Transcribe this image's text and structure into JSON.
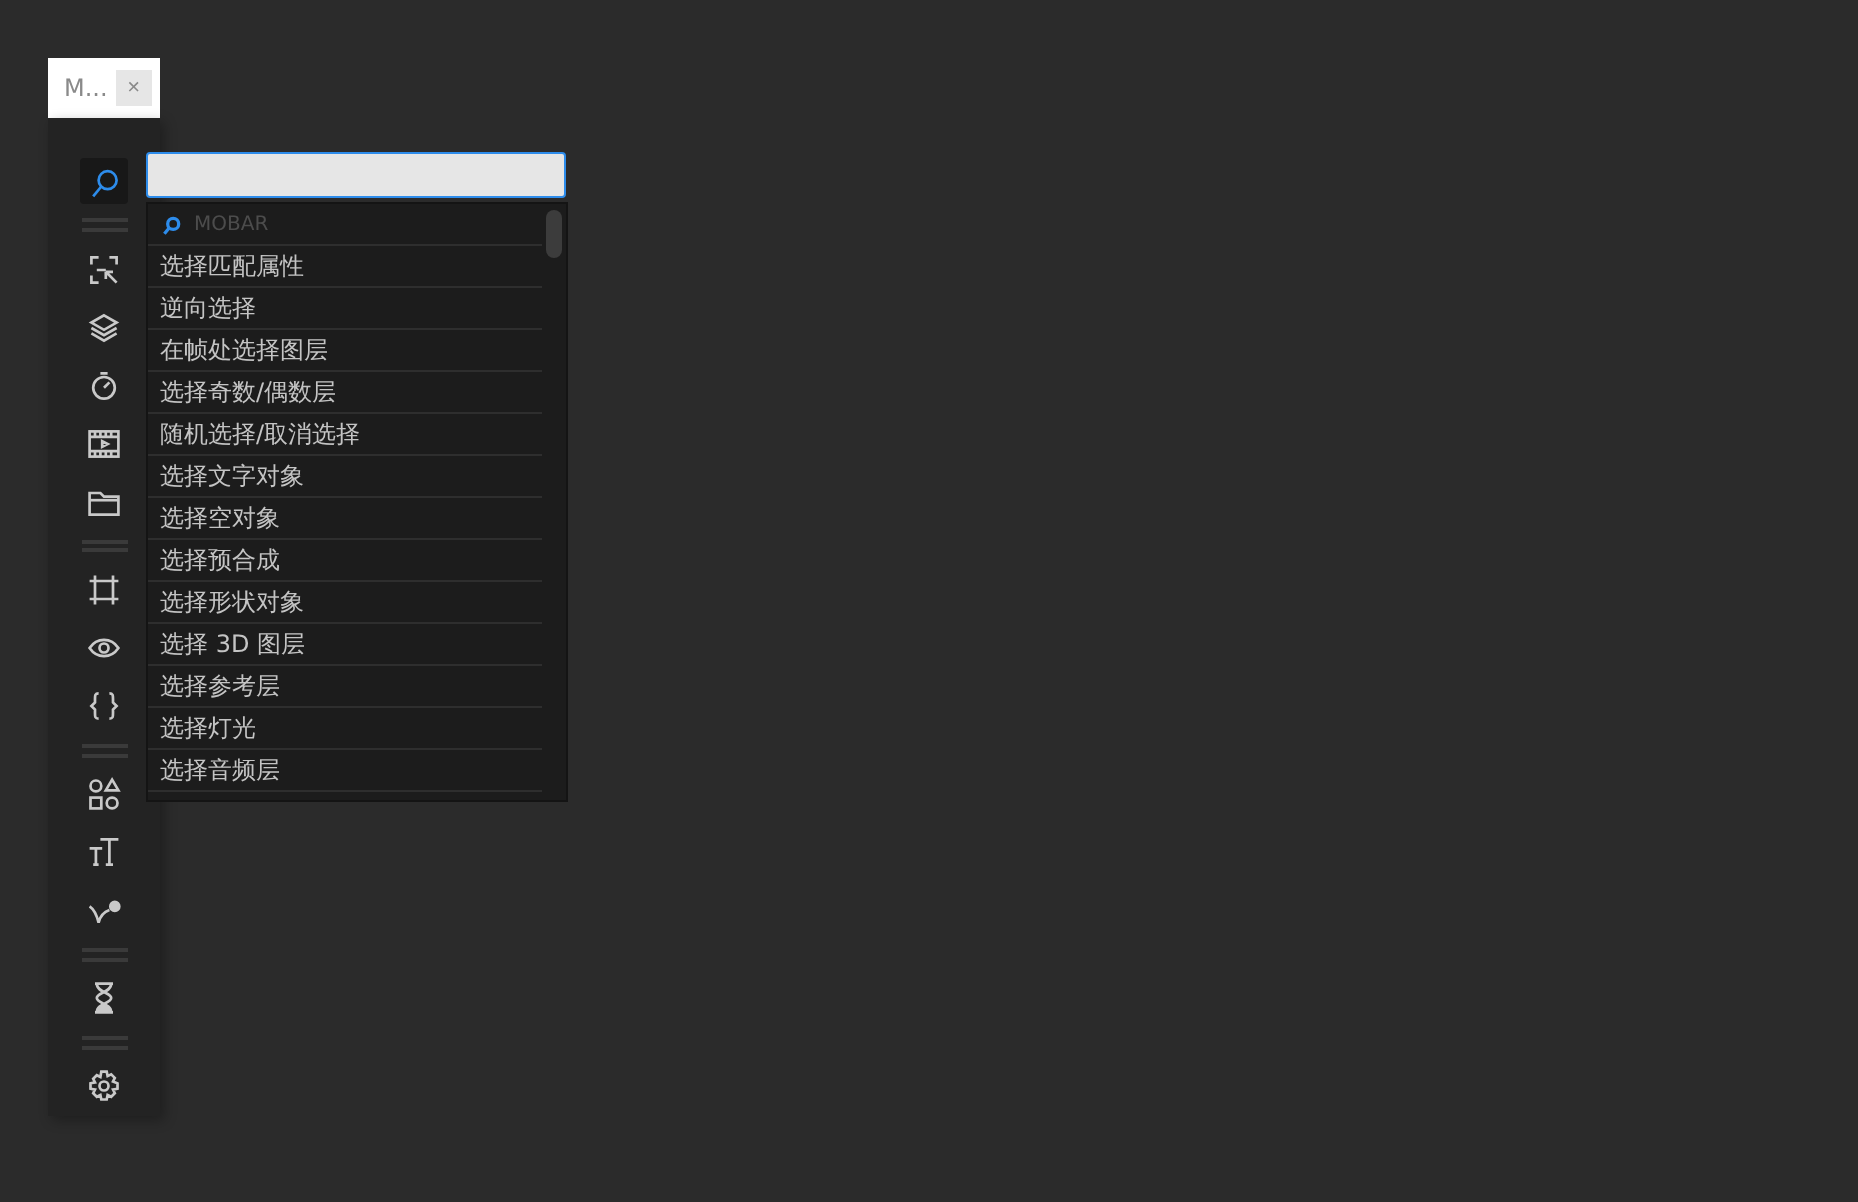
{
  "tab": {
    "label": "M...",
    "close": "×"
  },
  "sidebar": {
    "items": [
      {
        "kind": "button",
        "selected": true
      },
      {
        "kind": "divider"
      },
      {
        "kind": "button",
        "selected": false
      },
      {
        "kind": "button",
        "selected": false
      },
      {
        "kind": "button",
        "selected": false
      },
      {
        "kind": "button",
        "selected": false
      },
      {
        "kind": "button",
        "selected": false
      },
      {
        "kind": "divider"
      },
      {
        "kind": "button",
        "selected": false
      },
      {
        "kind": "button",
        "selected": false
      },
      {
        "kind": "button",
        "selected": false
      },
      {
        "kind": "divider"
      },
      {
        "kind": "button",
        "selected": false
      },
      {
        "kind": "button",
        "selected": false
      },
      {
        "kind": "button",
        "selected": false
      },
      {
        "kind": "divider"
      },
      {
        "kind": "button",
        "selected": false
      },
      {
        "kind": "divider"
      },
      {
        "kind": "button",
        "selected": false
      }
    ]
  },
  "dropdown": {
    "header": "MOBAR",
    "items": [
      "选择匹配属性",
      "逆向选择",
      "在帧处选择图层",
      "选择奇数/偶数层",
      "随机选择/取消选择",
      "选择文字对象",
      "选择空对象",
      "选择预合成",
      "选择形状对象",
      "选择 3D 图层",
      "选择参考层",
      "选择灯光",
      "选择音频层"
    ]
  }
}
